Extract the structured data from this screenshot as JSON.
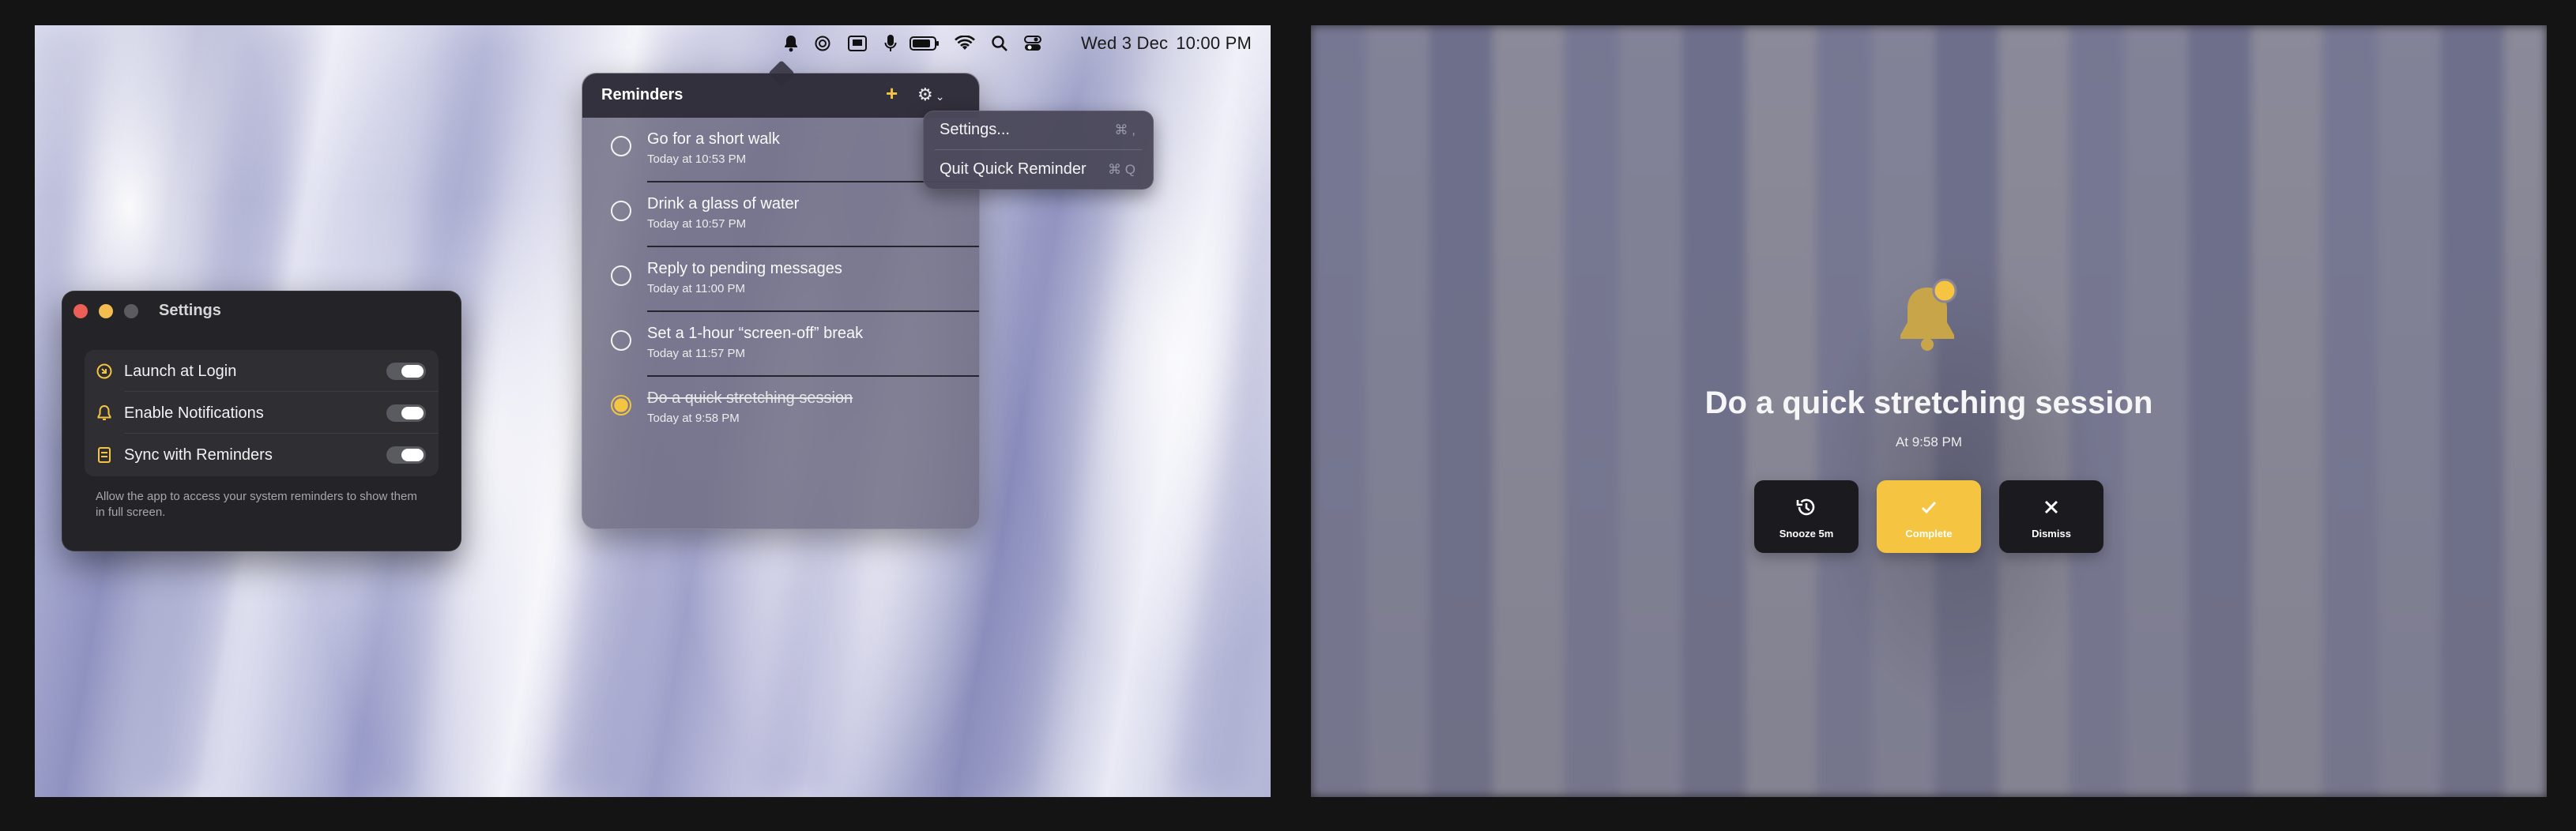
{
  "colors": {
    "accent": "#f5c542",
    "traffic_red": "#ec5f57",
    "traffic_yellow": "#f4bd4f",
    "traffic_gray": "#5b5b60"
  },
  "menubar": {
    "icons": [
      "bell-icon",
      "chatgpt-icon",
      "keyboard-icon",
      "microphone-icon",
      "battery-icon",
      "wifi-icon",
      "search-icon",
      "control-center-icon"
    ],
    "date": "Wed 3 Dec",
    "time": "10:00 PM"
  },
  "reminders_popover": {
    "title": "Reminders",
    "add_label": "+",
    "items": [
      {
        "title": "Go for a short walk",
        "time": "Today at 10:53 PM",
        "done": false
      },
      {
        "title": "Drink a glass of water",
        "time": "Today at 10:57 PM",
        "done": false
      },
      {
        "title": "Reply to pending messages",
        "time": "Today at 11:00 PM",
        "done": false
      },
      {
        "title": "Set a 1-hour “screen-off” break",
        "time": "Today at 11:57 PM",
        "done": false
      },
      {
        "title": "Do a quick stretching session",
        "time": "Today at 9:58 PM",
        "done": true
      }
    ]
  },
  "gear_menu": {
    "items": [
      {
        "label": "Settings...",
        "shortcut": "⌘ ,"
      },
      {
        "label": "Quit Quick Reminder",
        "shortcut": "⌘ Q"
      }
    ]
  },
  "settings_window": {
    "title": "Settings",
    "rows": [
      {
        "label": "Launch at Login",
        "icon": "login-icon",
        "enabled": true
      },
      {
        "label": "Enable Notifications",
        "icon": "bell-icon",
        "enabled": true
      },
      {
        "label": "Sync with Reminders",
        "icon": "list-icon",
        "enabled": true
      }
    ],
    "help": "Allow the app to access your system reminders to show them in full screen."
  },
  "fullscreen_alert": {
    "title": "Do a quick stretching session",
    "time": "At 9:58 PM",
    "buttons": [
      {
        "label": "Snooze 5m",
        "icon": "history-icon"
      },
      {
        "label": "Complete",
        "icon": "checkmark-icon"
      },
      {
        "label": "Dismiss",
        "icon": "close-icon"
      }
    ]
  }
}
